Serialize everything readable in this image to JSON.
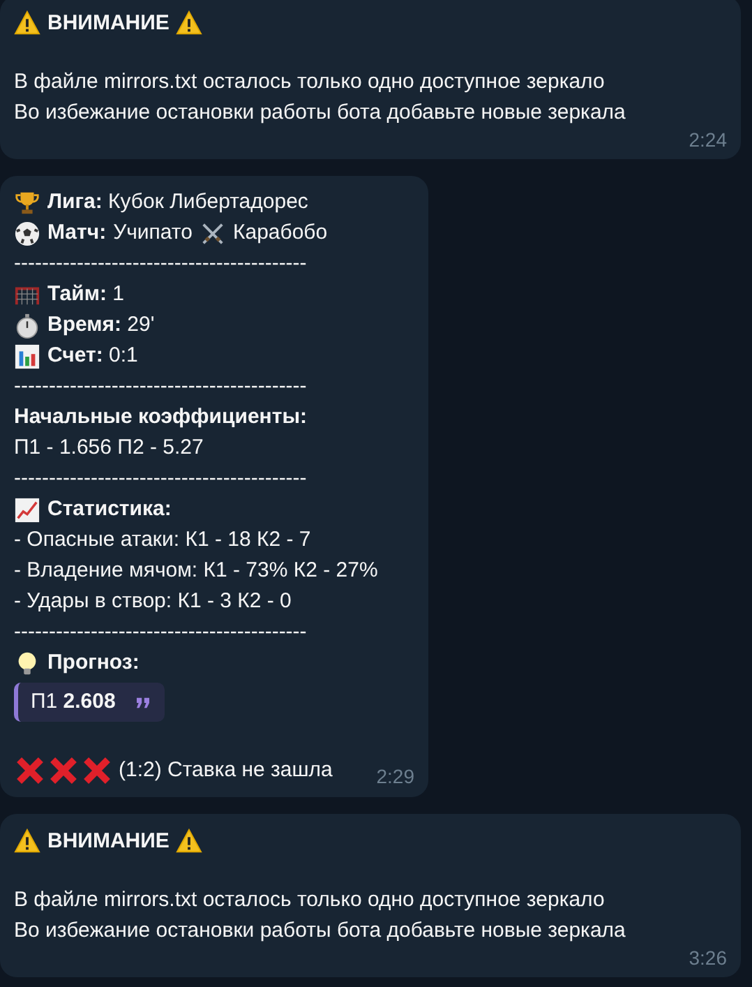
{
  "messages": [
    {
      "kind": "alert",
      "title": "ВНИМАНИЕ",
      "lines": [
        "В файле mirrors.txt осталось только одно доступное зеркало",
        "Во избежание остановки работы бота добавьте новые зеркала"
      ],
      "time": "2:24"
    },
    {
      "kind": "report",
      "lines": [
        {
          "kind": "league",
          "text": "**Лига:** Кубок Либертадорес"
        },
        {
          "kind": "match",
          "label": "Матч:",
          "home": "Учипато",
          "away": "Карабобо"
        },
        {
          "kind": "separator",
          "text": "------------------------------------------"
        },
        {
          "kind": "half",
          "text": "**Тайм:** 1"
        },
        {
          "kind": "time",
          "text": "**Время:** 29'"
        },
        {
          "kind": "score",
          "text": "**Счет:** 0:1"
        },
        {
          "kind": "separator",
          "text": "------------------------------------------"
        },
        {
          "kind": "heading",
          "text": "Начальные коэффициенты:"
        },
        {
          "kind": "plain",
          "text": "П1 - 1.656 П2 - 5.27"
        },
        {
          "kind": "separator",
          "text": "------------------------------------------"
        },
        {
          "kind": "stats",
          "text": "Статистика:"
        },
        {
          "kind": "plain",
          "text": "- Опасные атаки: К1 - 18 К2 - 7"
        },
        {
          "kind": "plain",
          "text": "- Владение мячом: К1 - 73% К2 - 27%"
        },
        {
          "kind": "plain",
          "text": "- Удары в створ: К1 - 3 К2 - 0"
        },
        {
          "kind": "separator",
          "text": "------------------------------------------"
        },
        {
          "kind": "forecast",
          "text": "Прогноз:"
        },
        {
          "kind": "quote",
          "text": "П1 **2.608**"
        },
        {
          "kind": "result",
          "text": "(1:2) Ставка не зашла"
        }
      ],
      "time": "2:29"
    },
    {
      "kind": "alert",
      "title": "ВНИМАНИЕ",
      "lines": [
        "В файле mirrors.txt осталось только одно доступное зеркало",
        "Во избежание остановки работы бота добавьте новые зеркала"
      ],
      "time": "3:26"
    }
  ]
}
